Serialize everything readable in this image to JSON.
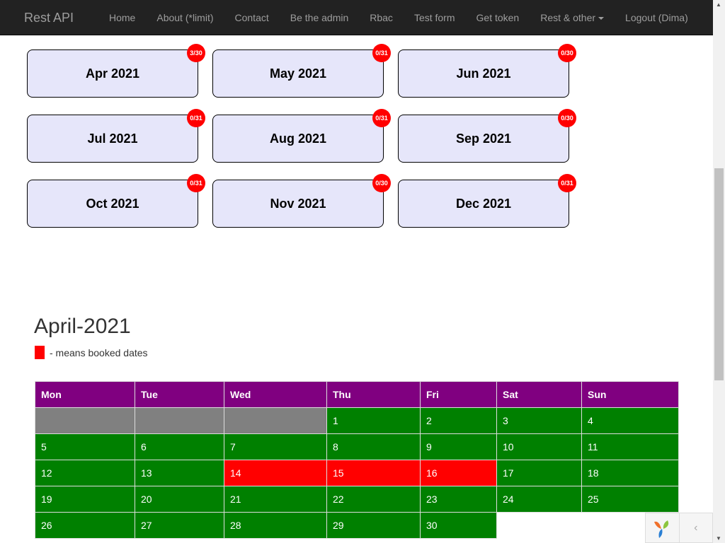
{
  "navbar": {
    "brand": "Rest API",
    "items": [
      "Home",
      "About (*limit)",
      "Contact",
      "Be the admin",
      "Rbac",
      "Test form",
      "Get token",
      "Rest & other",
      "Logout (Dima)"
    ]
  },
  "months": [
    {
      "label": "Apr 2021",
      "badge": "3/30"
    },
    {
      "label": "May 2021",
      "badge": "0/31"
    },
    {
      "label": "Jun 2021",
      "badge": "0/30"
    },
    {
      "label": "Jul 2021",
      "badge": "0/31"
    },
    {
      "label": "Aug 2021",
      "badge": "0/31"
    },
    {
      "label": "Sep 2021",
      "badge": "0/30"
    },
    {
      "label": "Oct 2021",
      "badge": "0/31"
    },
    {
      "label": "Nov 2021",
      "badge": "0/30"
    },
    {
      "label": "Dec 2021",
      "badge": "0/31"
    }
  ],
  "calendar": {
    "title": "April-2021",
    "legend": "- means booked dates",
    "headers": [
      "Mon",
      "Tue",
      "Wed",
      "Thu",
      "Fri",
      "Sat",
      "Sun"
    ],
    "weeks": [
      [
        "",
        "",
        "",
        "1",
        "2",
        "3",
        "4"
      ],
      [
        "5",
        "6",
        "7",
        "8",
        "9",
        "10",
        "11"
      ],
      [
        "12",
        "13",
        "14",
        "15",
        "16",
        "17",
        "18"
      ],
      [
        "19",
        "20",
        "21",
        "22",
        "23",
        "24",
        "25"
      ],
      [
        "26",
        "27",
        "28",
        "29",
        "30",
        "",
        ""
      ]
    ],
    "booked": [
      "14",
      "15",
      "16"
    ]
  },
  "colors": {
    "header": "#800080",
    "free": "#008000",
    "booked": "#f00",
    "empty": "#808080"
  }
}
